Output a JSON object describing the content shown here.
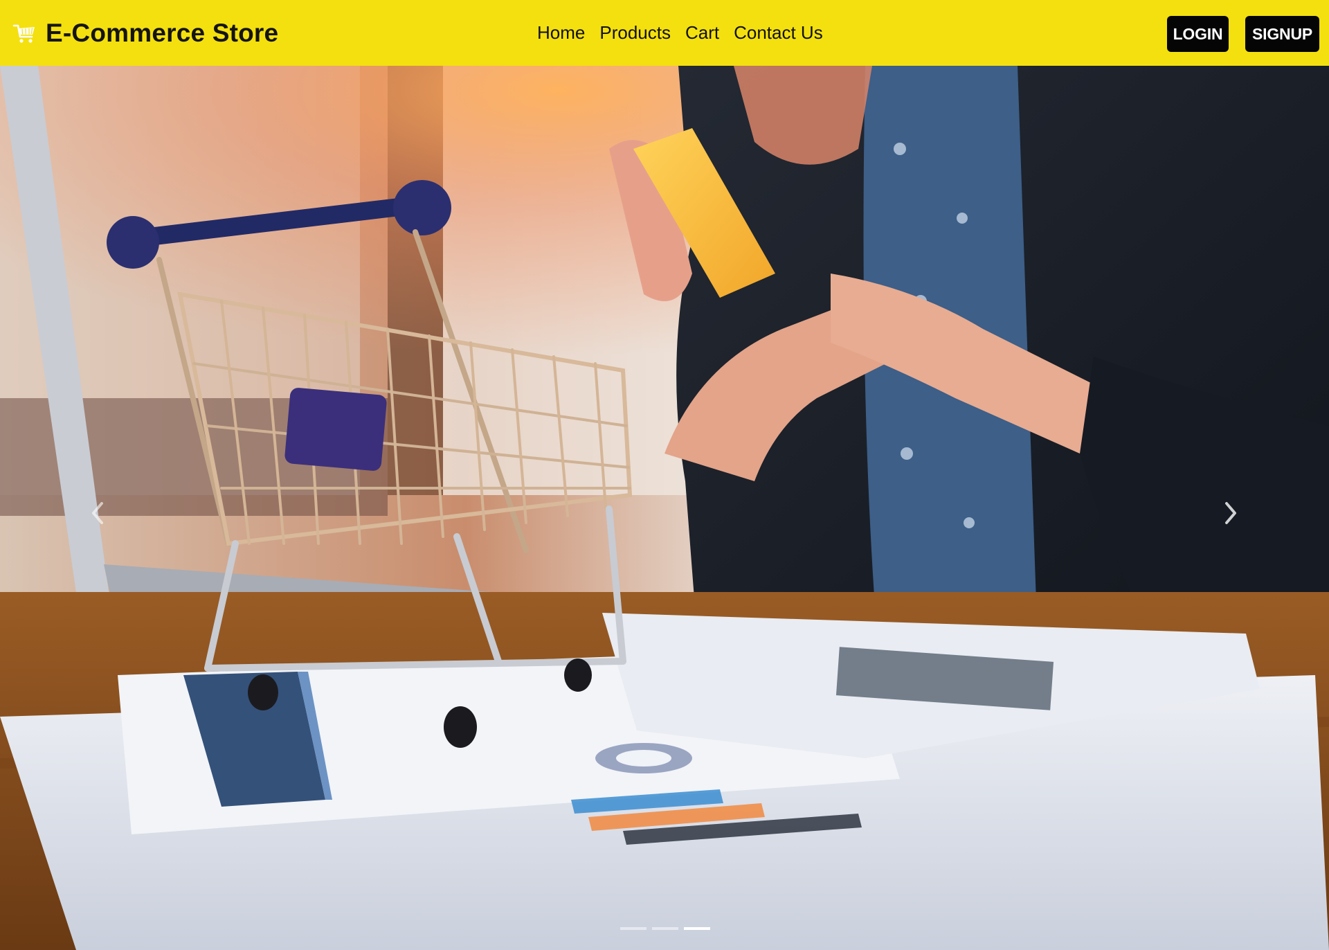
{
  "brand": {
    "name": "E-Commerce Store",
    "icon": "shopping-cart-icon",
    "color": "#f4e00e"
  },
  "nav": {
    "items": [
      {
        "label": "Home"
      },
      {
        "label": "Products"
      },
      {
        "label": "Cart"
      },
      {
        "label": "Contact Us"
      }
    ]
  },
  "auth": {
    "login_label": "LOGIN",
    "signup_label": "SIGNUP"
  },
  "carousel": {
    "slide_count": 3,
    "active_slide": 3,
    "prev_icon": "chevron-left-icon",
    "next_icon": "chevron-right-icon"
  }
}
